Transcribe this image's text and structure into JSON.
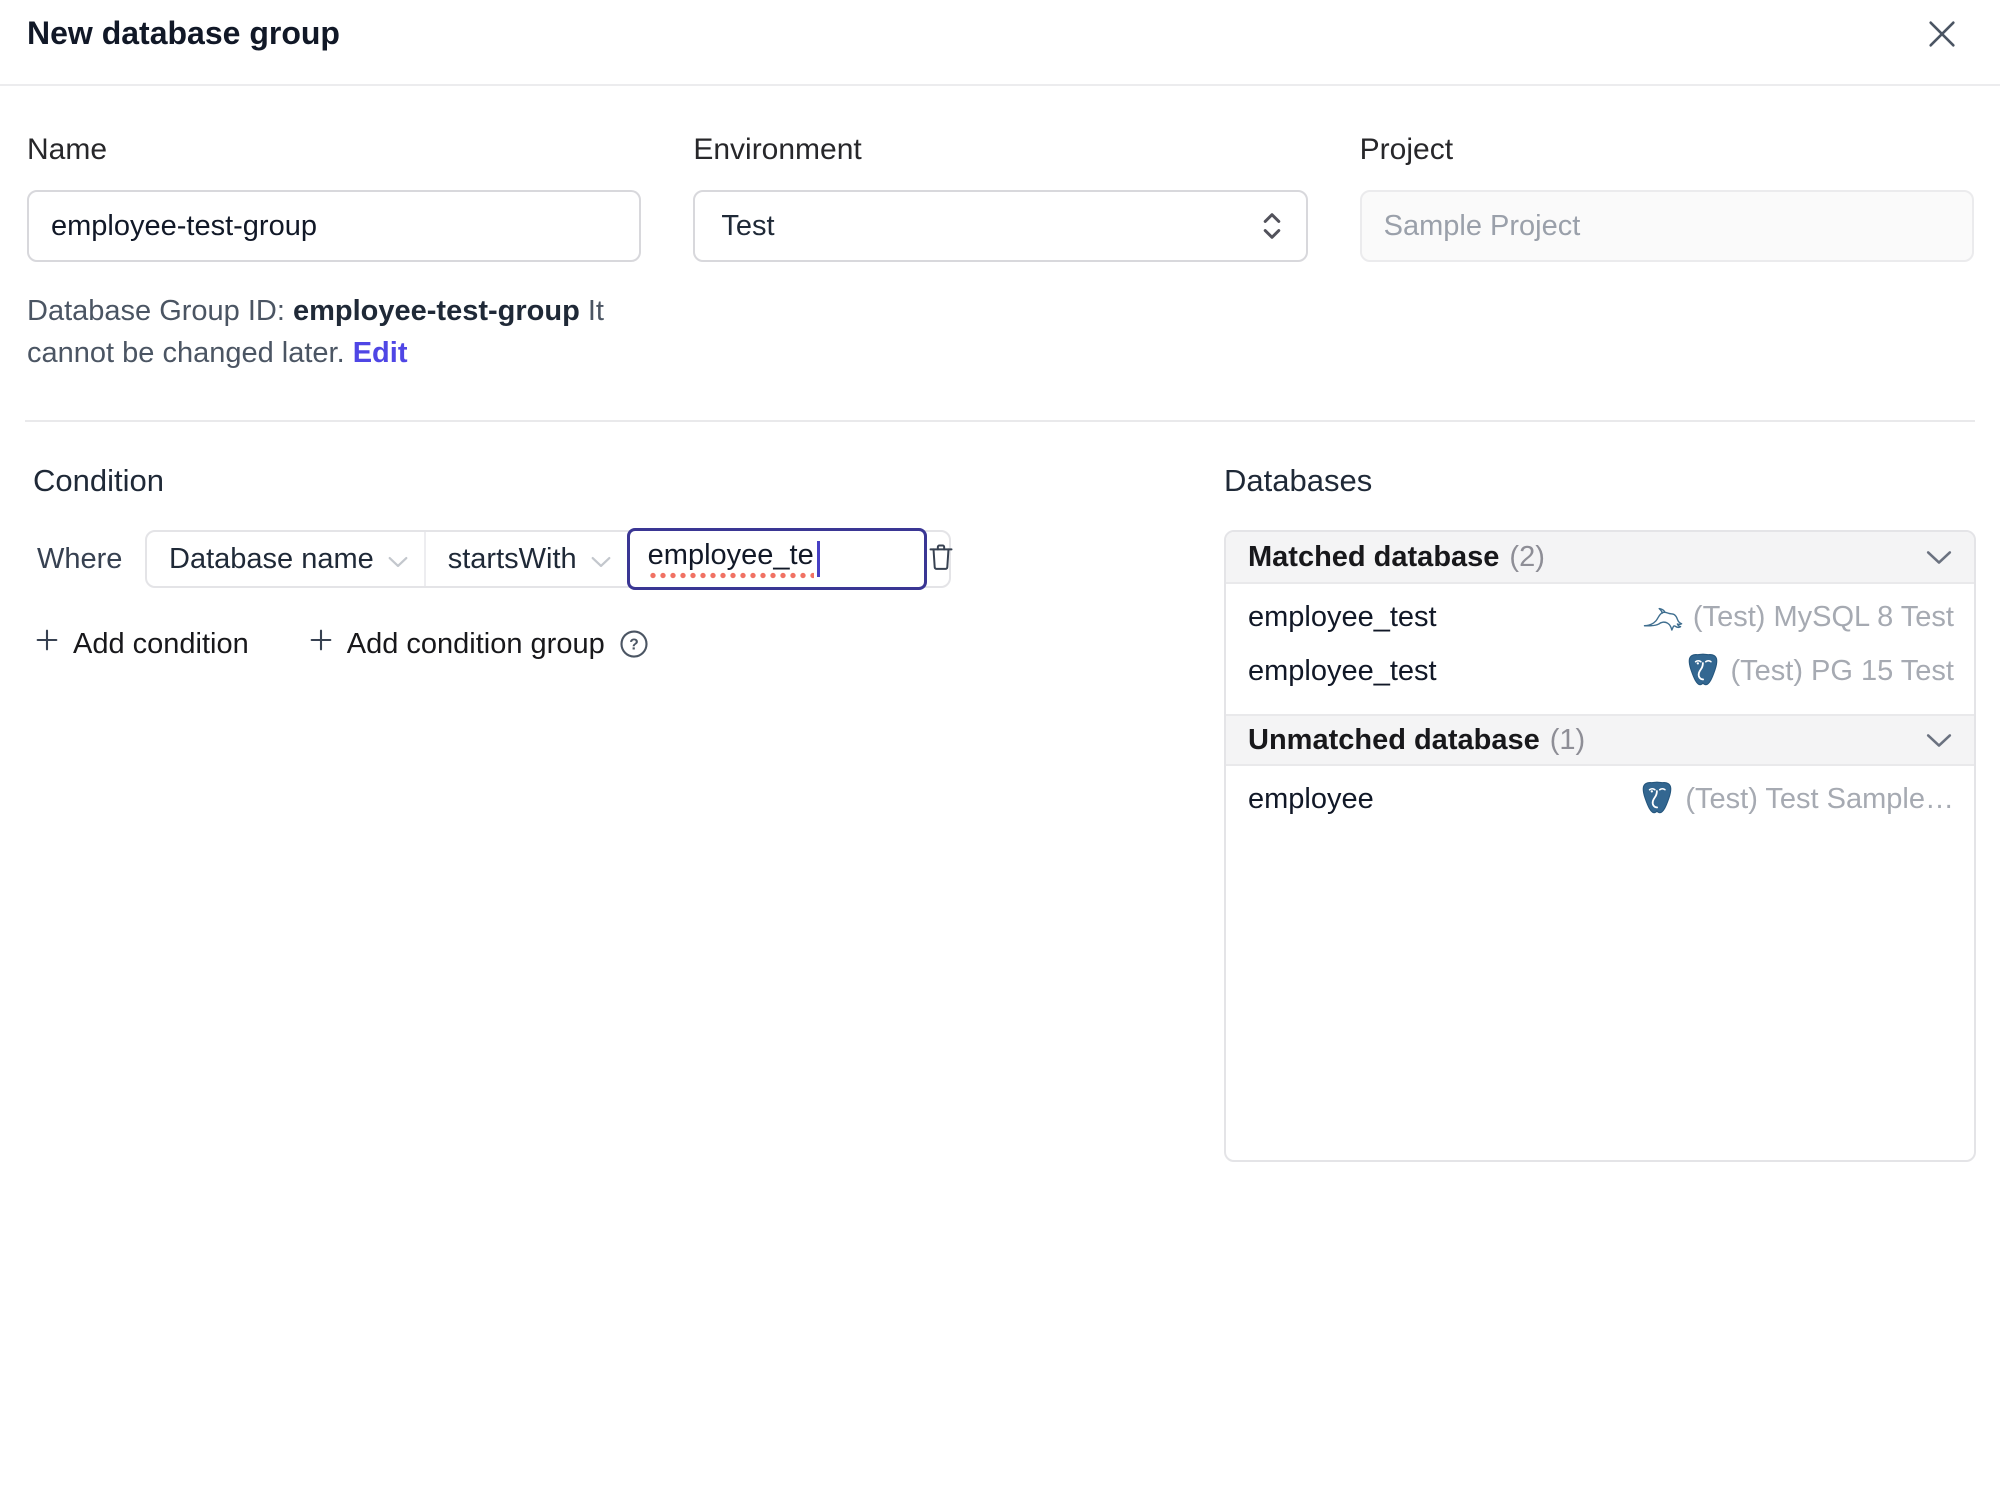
{
  "dialog": {
    "title": "New database group"
  },
  "form": {
    "name": {
      "label": "Name",
      "value": "employee-test-group"
    },
    "environment": {
      "label": "Environment",
      "value": "Test"
    },
    "project": {
      "label": "Project",
      "value": "Sample Project"
    },
    "group_id_hint": {
      "prefix": "Database Group ID: ",
      "id": "employee-test-group",
      "suffix": " It cannot be changed later. ",
      "edit_label": "Edit"
    }
  },
  "condition": {
    "heading": "Condition",
    "where_label": "Where",
    "factor": "Database name",
    "operator": "startsWith",
    "value": "employee_te",
    "add_condition_label": "Add condition",
    "add_condition_group_label": "Add condition group"
  },
  "databases": {
    "heading": "Databases",
    "matched": {
      "title": "Matched database",
      "count": "(2)",
      "rows": [
        {
          "name": "employee_test",
          "engine": "mysql",
          "instance": "(Test) MySQL 8 Test"
        },
        {
          "name": "employee_test",
          "engine": "postgresql",
          "instance": "(Test) PG 15 Test"
        }
      ]
    },
    "unmatched": {
      "title": "Unmatched database",
      "count": "(1)",
      "rows": [
        {
          "name": "employee",
          "engine": "postgresql",
          "instance": "(Test) Test Sample…"
        }
      ]
    }
  },
  "icons": {
    "close": "x-mark",
    "select_arrows": "up-down-chevrons",
    "dropdown_chevron": "chevron-down",
    "trash": "trash-can",
    "plus": "plus",
    "help": "question-mark-circle",
    "mysql": "mysql-dolphin",
    "postgresql": "postgres-elephant"
  },
  "colors": {
    "accent": "#4f46e5",
    "focus_border": "#3a3694",
    "caret": "#4740c4",
    "spellcheck_dots": "#f07264",
    "panel_border": "#e4e4e7",
    "section_header_bg": "#f4f4f5",
    "muted_text": "#a6aab2",
    "mysql_icon": "#3f6e8f",
    "postgres_icon": "#336791"
  }
}
